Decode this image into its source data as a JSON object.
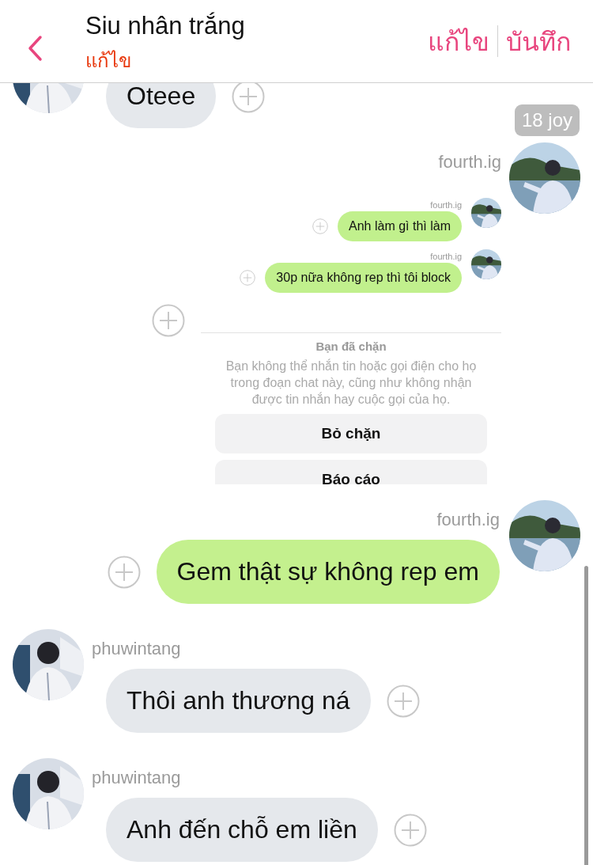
{
  "header": {
    "title": "Siu nhân trắng",
    "subtitle": "แก้ไข",
    "actions": [
      "แก้ไข",
      "บันทึก"
    ]
  },
  "messages": [
    {
      "kind": "text",
      "outgoing": false,
      "text": "Oteee"
    },
    {
      "kind": "time",
      "text": "18 joy"
    },
    {
      "kind": "screenshot",
      "sender": "fourth.ig",
      "screenshot": {
        "messages": [
          {
            "sender": "fourth.ig",
            "text": "Anh làm gì thì làm"
          },
          {
            "sender": "fourth.ig",
            "text": "30p nữa không rep thì tôi block"
          }
        ],
        "notice": {
          "title": "Bạn đã chặn",
          "body": "Bạn không thể nhắn tin hoặc gọi điện cho họ trong đoạn chat này, cũng như không nhận được tin nhắn hay cuộc gọi của họ."
        },
        "buttons": [
          "Bỏ chặn",
          "Báo cáo"
        ]
      }
    },
    {
      "kind": "text",
      "outgoing": true,
      "sender": "fourth.ig",
      "text": "Gem thật sự không rep em"
    },
    {
      "kind": "text",
      "outgoing": false,
      "sender": "phuwintang",
      "text": "Thôi anh thương ná"
    },
    {
      "kind": "text",
      "outgoing": false,
      "sender": "phuwintang",
      "text": "Anh đến chỗ em liền"
    }
  ]
}
